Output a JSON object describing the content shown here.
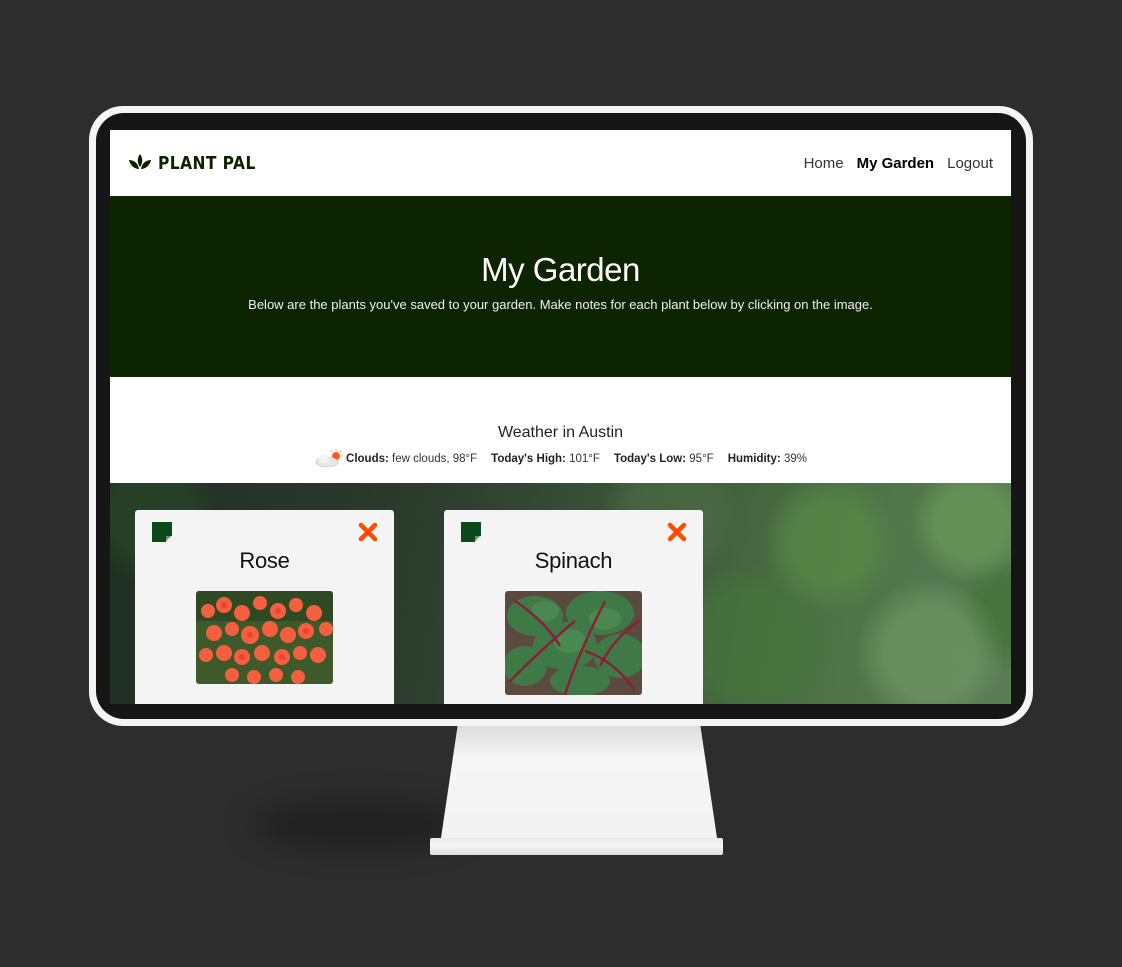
{
  "brand": {
    "name": "PLANT PAL",
    "color": "#0b2200"
  },
  "nav": {
    "home": "Home",
    "my_garden": "My Garden",
    "logout": "Logout"
  },
  "hero": {
    "title": "My Garden",
    "subtitle": "Below are the plants you've saved to your garden. Make notes for each plant below by clicking on the image.",
    "background": "#0c2400"
  },
  "weather": {
    "heading": "Weather in Austin",
    "icon": "partly-cloudy-icon",
    "clouds_label": "Clouds:",
    "clouds_value": "few clouds, 98°F",
    "high_label": "Today's High:",
    "high_value": "101°F",
    "low_label": "Today's Low:",
    "low_value": "95°F",
    "humidity_label": "Humidity:",
    "humidity_value": "39%"
  },
  "plants": [
    {
      "name": "Rose",
      "note_icon": "note-icon",
      "remove_icon": "close-icon",
      "accent": "#ff4a00"
    },
    {
      "name": "Spinach",
      "note_icon": "note-icon",
      "remove_icon": "close-icon",
      "accent": "#ff4a00"
    }
  ],
  "colors": {
    "note_icon": "#0d4a1a",
    "remove_icon": "#ff4a00"
  }
}
